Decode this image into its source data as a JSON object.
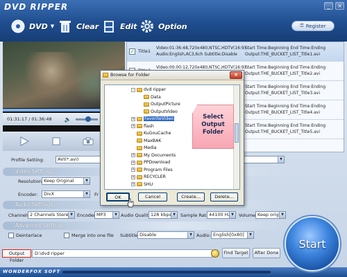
{
  "app": {
    "title": "DVD RIPPER",
    "brand": "WONDERFOX SOFT"
  },
  "toolbar": {
    "dvd_label": "DVD",
    "clear_label": "Clear",
    "edit_label": "Edit",
    "option_label": "Option",
    "register_label": "Register"
  },
  "window": {
    "minimize": "_",
    "close": "×"
  },
  "player": {
    "current_time": "01:31:17",
    "separator": "/",
    "total_time": "01:36:48",
    "progress_fraction": 0.94,
    "volume_fraction": 0.6
  },
  "titles": [
    {
      "name": "Title1",
      "checked": true,
      "info_line1": "Video:01:36:48,720x480,NTSC,HDTV(16:9)",
      "info_line2": "Audio:English,AC3,6ch Subtitle:Disable",
      "time_line": "Start Time:Beginning End Time:Ending",
      "output_line": "Output:THE_BUCKET_LIST_Title1.avi"
    },
    {
      "name": "Title2",
      "checked": false,
      "info_line1": "Video:00:00:12,720x480,NTSC,HDTV(16:9)",
      "info_line2": "Audio:English,AC3,6ch Subtitle:Disable",
      "time_line": "Start Time:Beginning End Time:Ending",
      "output_line": "Output:THE_BUCKET_LIST_Title2.avi"
    },
    {
      "name": "Title3",
      "checked": false,
      "info_line1": "",
      "info_line2": "",
      "time_line": "Start Time:Beginning End Time:Ending",
      "output_line": "Output:THE_BUCKET_LIST_Title3.avi"
    },
    {
      "name": "Title4",
      "checked": false,
      "info_line1": "",
      "info_line2": "",
      "time_line": "Start Time:Beginning End Time:Ending",
      "output_line": "Output:THE_BUCKET_LIST_Title4.avi"
    },
    {
      "name": "Title5",
      "checked": false,
      "info_line1": "",
      "info_line2": "",
      "time_line": "Start Time:Beginning End Time:Ending",
      "output_line": "Output:THE_BUCKET_LIST_Title5.avi"
    }
  ],
  "settings": {
    "profile_label": "Profile Setting:",
    "profile_value": "AVI(*.avi)",
    "video_section": "Video Settings",
    "resolution_label": "Resolution:",
    "resolution_value": "Keep Original",
    "encoder_label": "Encoder:",
    "encoder_value": "DivX",
    "fr_label": "Fr",
    "audio_section": "Audio Settings",
    "channels_label": "Channels:",
    "channels_value": "2 Channels Stereo",
    "audio_encoder_label": "Encoder:",
    "audio_encoder_value": "MP3",
    "audio_quality_label": "Audio Quality:",
    "audio_quality_value": "128 kbps",
    "sample_rate_label": "Sample Rate:",
    "sample_rate_value": "44100 Hz",
    "volume_label": "Volume:",
    "volume_value": "Keep origina",
    "advanced_section": "Advanced Settings",
    "deinterlace_label": "Deinterlace",
    "merge_label": "Merge into one file",
    "subtitle_label": "Subtitle:",
    "subtitle_value": "Disable",
    "audio_track_label": "Audio:",
    "audio_track_value": "English[0x80]"
  },
  "output": {
    "label": "Output Folder",
    "path": "D:\\dvd ripper",
    "find_target": "Find Target",
    "after_done": "After Done"
  },
  "start_label": "Start",
  "dialog": {
    "title": "Browse for Folder",
    "close": "×",
    "tree": [
      {
        "label": "dvd ripper",
        "expander": "-",
        "indent": 0,
        "selected": false
      },
      {
        "label": "Data",
        "expander": "",
        "indent": 1,
        "selected": false
      },
      {
        "label": "OutputPicture",
        "expander": "",
        "indent": 1,
        "selected": false
      },
      {
        "label": "OutputVideo",
        "expander": "",
        "indent": 1,
        "selected": false
      },
      {
        "label": "FavoriteVideo",
        "expander": "+",
        "indent": 0,
        "selected": true
      },
      {
        "label": "flash",
        "expander": "+",
        "indent": 0,
        "selected": false
      },
      {
        "label": "KuGouCache",
        "expander": "",
        "indent": 0,
        "selected": false
      },
      {
        "label": "MaxBAK",
        "expander": "",
        "indent": 0,
        "selected": false
      },
      {
        "label": "Media",
        "expander": "",
        "indent": 0,
        "selected": false
      },
      {
        "label": "My Documents",
        "expander": "+",
        "indent": 0,
        "selected": false
      },
      {
        "label": "PPDownload",
        "expander": "+",
        "indent": 0,
        "selected": false
      },
      {
        "label": "Program Files",
        "expander": "+",
        "indent": 0,
        "selected": false
      },
      {
        "label": "RECYCLER",
        "expander": "+",
        "indent": 0,
        "selected": false
      },
      {
        "label": "SHU",
        "expander": "+",
        "indent": 0,
        "selected": false
      }
    ],
    "callout": "Select Output Folder",
    "ok": "OK",
    "cancel": "Cancel",
    "create": "Create...",
    "delete": "Delete..."
  }
}
